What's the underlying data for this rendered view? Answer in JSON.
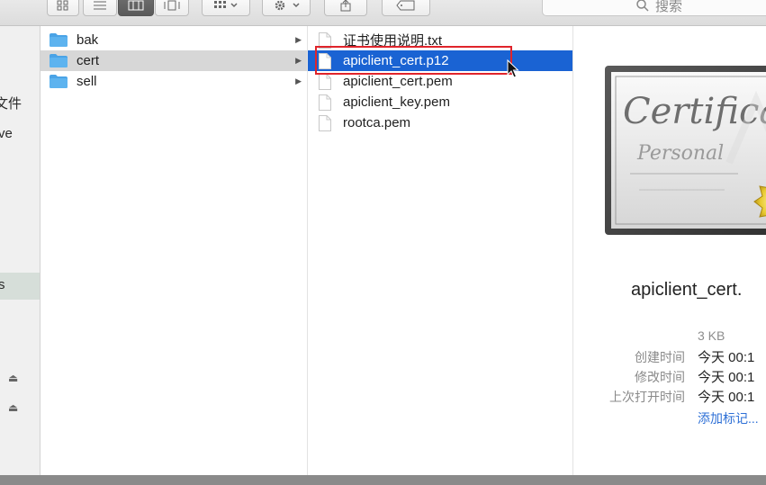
{
  "toolbar": {
    "search_placeholder": "搜索",
    "view_buttons": [
      "icon-view-icon",
      "list-view-icon",
      "column-view-icon",
      "cover-flow-icon"
    ]
  },
  "sidebar": {
    "items": [
      {
        "label": "文件"
      },
      {
        "label": "ve"
      },
      {
        "label": "s"
      }
    ]
  },
  "columns": {
    "folders": [
      {
        "label": "bak",
        "selected": false
      },
      {
        "label": "cert",
        "selected": true
      },
      {
        "label": "sell",
        "selected": false
      }
    ],
    "files": [
      {
        "label": "证书使用说明.txt",
        "selected": false
      },
      {
        "label": "apiclient_cert.p12",
        "selected": true
      },
      {
        "label": "apiclient_cert.pem",
        "selected": false
      },
      {
        "label": "apiclient_key.pem",
        "selected": false
      },
      {
        "label": "rootca.pem",
        "selected": false
      }
    ]
  },
  "preview": {
    "cert_title": "Certifica",
    "cert_subtitle": "Personal",
    "filename": "apiclient_cert.",
    "size": "3 KB",
    "created_label": "创建时间",
    "created_value": "今天 00:1",
    "modified_label": "修改时间",
    "modified_value": "今天 00:1",
    "opened_label": "上次打开时间",
    "opened_value": "今天 00:1",
    "add_tags": "添加标记..."
  },
  "colors": {
    "selection_blue": "#1a63d3",
    "highlight_red": "#e0242b",
    "folder_blue": "#4aa3e6"
  }
}
